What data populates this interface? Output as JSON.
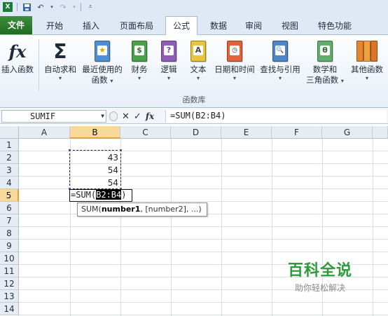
{
  "qat": {
    "save_icon": "save-icon",
    "undo_icon": "undo-icon",
    "redo_icon": "redo-icon",
    "customize_icon": "customize-qat-icon"
  },
  "tabs": [
    {
      "label": "文件",
      "kind": "file"
    },
    {
      "label": "开始"
    },
    {
      "label": "插入"
    },
    {
      "label": "页面布局"
    },
    {
      "label": "公式",
      "active": true
    },
    {
      "label": "数据"
    },
    {
      "label": "审阅"
    },
    {
      "label": "视图"
    },
    {
      "label": "特色功能"
    }
  ],
  "ribbon": {
    "insert_function": "插入函数",
    "autosum": {
      "line1": "自动求和",
      "arrow": "▾"
    },
    "recent": {
      "line1": "最近使用的",
      "line2": "函数",
      "arrow": "▾"
    },
    "finance": {
      "line1": "财务",
      "arrow": "▾"
    },
    "logic": {
      "line1": "逻辑",
      "arrow": "▾"
    },
    "text": {
      "line1": "文本",
      "arrow": "▾"
    },
    "datetime": {
      "line1": "日期和时间",
      "arrow": "▾"
    },
    "lookup": {
      "line1": "查找与引用",
      "arrow": "▾"
    },
    "math": {
      "line1": "数学和",
      "line2": "三角函数",
      "arrow": "▾"
    },
    "other": {
      "line1": "其他函数",
      "arrow": "▾"
    },
    "group_label": "函数库",
    "icons": {
      "fx": "fx",
      "sigma": "Σ",
      "recent": "★",
      "finance": "$",
      "logic": "?",
      "text": "A",
      "lookup": "🔍",
      "math": "θ"
    }
  },
  "formula_bar": {
    "name_box": "SUMIF",
    "formula": "=SUM(B2:B4)",
    "cancel": "✕",
    "enter": "✓",
    "fx": "fx"
  },
  "grid": {
    "columns": [
      "A",
      "B",
      "C",
      "D",
      "E",
      "F",
      "G"
    ],
    "rows": [
      "1",
      "2",
      "3",
      "4",
      "5",
      "6",
      "7",
      "8",
      "9",
      "10",
      "11",
      "12",
      "13",
      "14"
    ],
    "selected_column": "B",
    "selected_row": "5",
    "cells": {
      "B2": "43",
      "B3": "54",
      "B4": "54"
    },
    "edit_cell": {
      "prefix": "=SUM(",
      "ref": "B2:B4",
      "suffix": ")"
    },
    "tooltip": {
      "fn": "SUM(",
      "arg1": "number1",
      "rest": ", [number2], ...)"
    }
  },
  "watermark": {
    "line1": "百科全说",
    "line2": "助你轻松解决"
  }
}
